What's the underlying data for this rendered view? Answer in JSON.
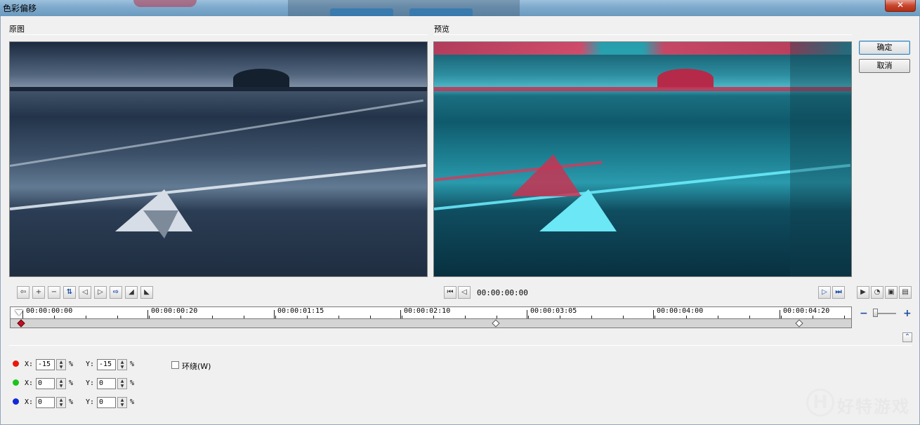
{
  "window": {
    "title": "色彩偏移",
    "close_glyph": "✕"
  },
  "labels": {
    "original": "原图",
    "preview": "预览"
  },
  "buttons": {
    "ok": "确定",
    "cancel": "取消"
  },
  "edit_toolbar": [
    {
      "name": "prev-keyframe",
      "glyph": "⇦"
    },
    {
      "name": "add-keyframe",
      "glyph": "+"
    },
    {
      "name": "remove-keyframe",
      "glyph": "−"
    },
    {
      "name": "reverse-keyframes",
      "glyph": "⇅"
    },
    {
      "name": "move-left",
      "glyph": "◁"
    },
    {
      "name": "move-right",
      "glyph": "▷"
    },
    {
      "name": "next-keyframe",
      "glyph": "⇨"
    },
    {
      "name": "fade-in",
      "glyph": "◢"
    },
    {
      "name": "fade-out",
      "glyph": "◣"
    }
  ],
  "playback": {
    "timecode": "00:00:00:00"
  },
  "timeline": {
    "ticks": [
      "00:00:00:00",
      "00:00:00:20",
      "00:00:01:15",
      "00:00:02:10",
      "00:00:03:05",
      "00:00:04:00",
      "00:00:04:20"
    ],
    "keyframes": [
      0.0,
      0.575,
      0.943
    ],
    "selected_keyframe": 0
  },
  "color_rows": [
    {
      "color": "#e8190c",
      "x_label": "X:",
      "x": "-15",
      "y_label": "Y:",
      "y": "-15",
      "unit": "%"
    },
    {
      "color": "#1cc41c",
      "x_label": "X:",
      "x": "0",
      "y_label": "Y:",
      "y": "0",
      "unit": "%"
    },
    {
      "color": "#1328d6",
      "x_label": "X:",
      "x": "0",
      "y_label": "Y:",
      "y": "0",
      "unit": "%"
    }
  ],
  "wrap": {
    "label": "环绕(W)",
    "checked": false
  },
  "watermark": {
    "mark": "H",
    "text": "好特游戏"
  }
}
